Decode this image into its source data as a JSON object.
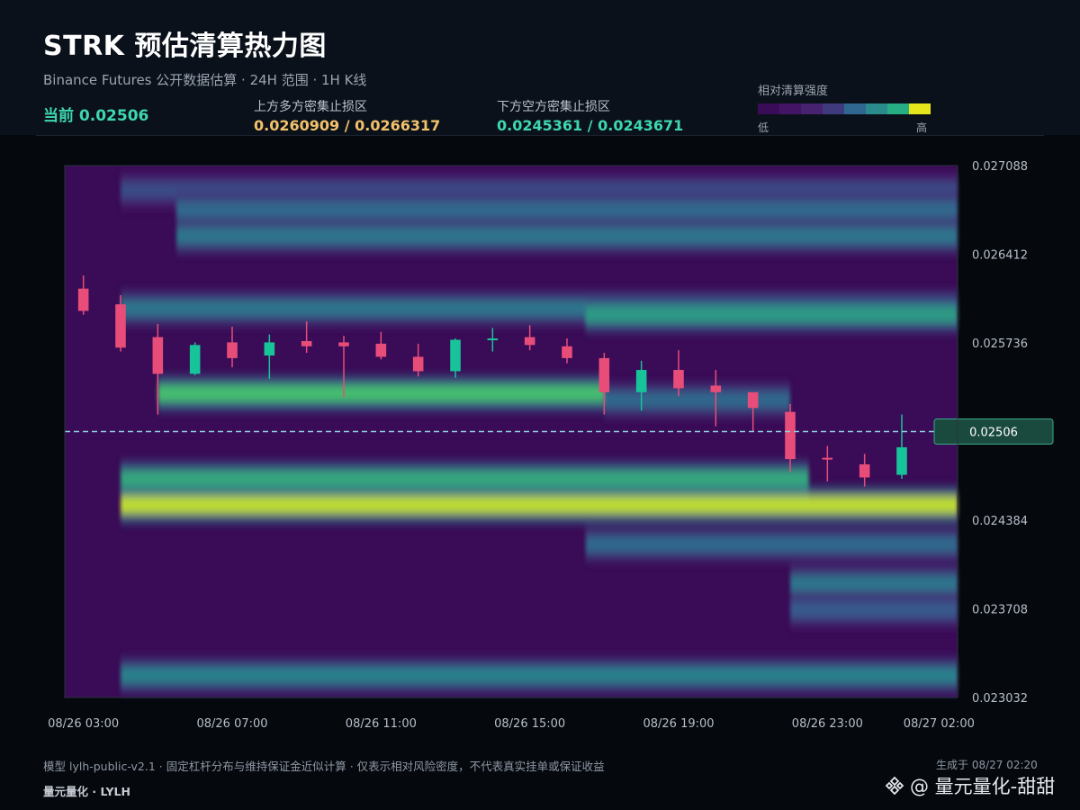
{
  "header": {
    "title": "STRK 预估清算热力图",
    "subtitle": "Binance Futures 公开数据估算 · 24H 范围 · 1H K线",
    "current_label": "当前 0.02506",
    "upper_zone_label": "上方多方密集止损区",
    "upper_zone_value": "0.0260909 / 0.0266317",
    "lower_zone_label": "下方空方密集止损区",
    "lower_zone_value": "0.0245361 / 0.0243671",
    "legend_title": "相对清算强度",
    "legend_low": "低",
    "legend_high": "高"
  },
  "colors": {
    "up": "#e84d79",
    "down": "#17c49a",
    "legend": [
      "#3a0b56",
      "#431466",
      "#46226f",
      "#3f3a7e",
      "#2f6790",
      "#2a8a8c",
      "#26ad83",
      "#e6e51b"
    ]
  },
  "chart_data": {
    "type": "heatmap",
    "title": "STRK 预估清算热力图",
    "current_price": 0.02506,
    "current_price_label": "0.02506",
    "ylim": [
      0.023032,
      0.027088
    ],
    "y_ticks": [
      "0.027088",
      "0.026412",
      "0.025736",
      "0.025060",
      "0.024384",
      "0.023708",
      "0.023032"
    ],
    "y_tick_labels_shown": [
      "0.027088",
      "0.026412",
      "0.025736",
      "",
      "0.024384",
      "0.023708",
      "0.023032"
    ],
    "x_tick_labels": [
      "08/26 03:00",
      "08/26 07:00",
      "08/26 11:00",
      "08/26 15:00",
      "08/26 19:00",
      "08/26 23:00",
      "08/27 02:00"
    ],
    "x_tick_hours": [
      0,
      4,
      8,
      12,
      16,
      20,
      23
    ],
    "hours": 24,
    "candles": [
      {
        "t": "08/26 03:00",
        "o": 0.02615,
        "h": 0.02625,
        "l": 0.02595,
        "c": 0.02598
      },
      {
        "t": "08/26 04:00",
        "o": 0.02603,
        "h": 0.0261,
        "l": 0.02567,
        "c": 0.0257
      },
      {
        "t": "08/26 05:00",
        "o": 0.02578,
        "h": 0.02588,
        "l": 0.02519,
        "c": 0.0255
      },
      {
        "t": "08/26 06:00",
        "o": 0.0255,
        "h": 0.02574,
        "l": 0.02549,
        "c": 0.02572
      },
      {
        "t": "08/26 07:00",
        "o": 0.02574,
        "h": 0.02586,
        "l": 0.02555,
        "c": 0.02562
      },
      {
        "t": "08/26 08:00",
        "o": 0.02564,
        "h": 0.0258,
        "l": 0.02546,
        "c": 0.02574
      },
      {
        "t": "08/26 09:00",
        "o": 0.02575,
        "h": 0.0259,
        "l": 0.02566,
        "c": 0.02571
      },
      {
        "t": "08/26 10:00",
        "o": 0.02574,
        "h": 0.02579,
        "l": 0.02532,
        "c": 0.02571
      },
      {
        "t": "08/26 11:00",
        "o": 0.02573,
        "h": 0.02582,
        "l": 0.02561,
        "c": 0.02563
      },
      {
        "t": "08/26 12:00",
        "o": 0.02563,
        "h": 0.02573,
        "l": 0.02548,
        "c": 0.02552
      },
      {
        "t": "08/26 13:00",
        "o": 0.02552,
        "h": 0.02577,
        "l": 0.02547,
        "c": 0.02576
      },
      {
        "t": "08/26 14:00",
        "o": 0.02577,
        "h": 0.02585,
        "l": 0.02567,
        "c": 0.02577
      },
      {
        "t": "08/26 15:00",
        "o": 0.02578,
        "h": 0.02587,
        "l": 0.02568,
        "c": 0.02572
      },
      {
        "t": "08/26 16:00",
        "o": 0.02571,
        "h": 0.02577,
        "l": 0.02558,
        "c": 0.02562
      },
      {
        "t": "08/26 17:00",
        "o": 0.02562,
        "h": 0.02566,
        "l": 0.02519,
        "c": 0.02536
      },
      {
        "t": "08/26 18:00",
        "o": 0.02536,
        "h": 0.0256,
        "l": 0.02522,
        "c": 0.02553
      },
      {
        "t": "08/26 19:00",
        "o": 0.02553,
        "h": 0.02568,
        "l": 0.02533,
        "c": 0.02539
      },
      {
        "t": "08/26 20:00",
        "o": 0.02541,
        "h": 0.02553,
        "l": 0.0251,
        "c": 0.02536
      },
      {
        "t": "08/26 21:00",
        "o": 0.02536,
        "h": 0.02535,
        "l": 0.02506,
        "c": 0.02524
      },
      {
        "t": "08/26 22:00",
        "o": 0.02521,
        "h": 0.02527,
        "l": 0.02475,
        "c": 0.02485
      },
      {
        "t": "08/26 23:00",
        "o": 0.02486,
        "h": 0.02495,
        "l": 0.02468,
        "c": 0.02485
      },
      {
        "t": "08/27 00:00",
        "o": 0.02481,
        "h": 0.02489,
        "l": 0.02464,
        "c": 0.02471
      },
      {
        "t": "08/27 01:00",
        "o": 0.02473,
        "h": 0.02519,
        "l": 0.0247,
        "c": 0.02494
      }
    ],
    "heat_bands": [
      {
        "price": 0.0269,
        "intensity": 0.35,
        "start_hour": 1.5
      },
      {
        "price": 0.02675,
        "intensity": 0.45,
        "start_hour": 3.0
      },
      {
        "price": 0.02655,
        "intensity": 0.5,
        "start_hour": 3.0
      },
      {
        "price": 0.026,
        "intensity": 0.5,
        "start_hour": 1.5
      },
      {
        "price": 0.02595,
        "intensity": 0.65,
        "start_hour": 14.0
      },
      {
        "price": 0.02535,
        "intensity": 0.8,
        "start_hour": 2.5,
        "end_hour": 14.5
      },
      {
        "price": 0.0253,
        "intensity": 0.45,
        "start_hour": 14.5,
        "end_hour": 19.5
      },
      {
        "price": 0.0247,
        "intensity": 0.7,
        "start_hour": 1.5,
        "end_hour": 20.0
      },
      {
        "price": 0.0245,
        "intensity": 0.95,
        "start_hour": 1.5
      },
      {
        "price": 0.0242,
        "intensity": 0.45,
        "start_hour": 14.0
      },
      {
        "price": 0.0239,
        "intensity": 0.5,
        "start_hour": 19.5
      },
      {
        "price": 0.0237,
        "intensity": 0.4,
        "start_hour": 19.5
      },
      {
        "price": 0.0232,
        "intensity": 0.55,
        "start_hour": 1.5
      }
    ]
  },
  "footer": {
    "note": "模型 lylh-public-v2.1 · 固定杠杆分布与维持保证金近似计算 · 仅表示相对风险密度，不代表真实挂单或保证收益",
    "brand": "量元量化 · LYLH",
    "generated": "生成于 08/27 02:20",
    "watermark": "@ 量元量化-甜甜"
  }
}
